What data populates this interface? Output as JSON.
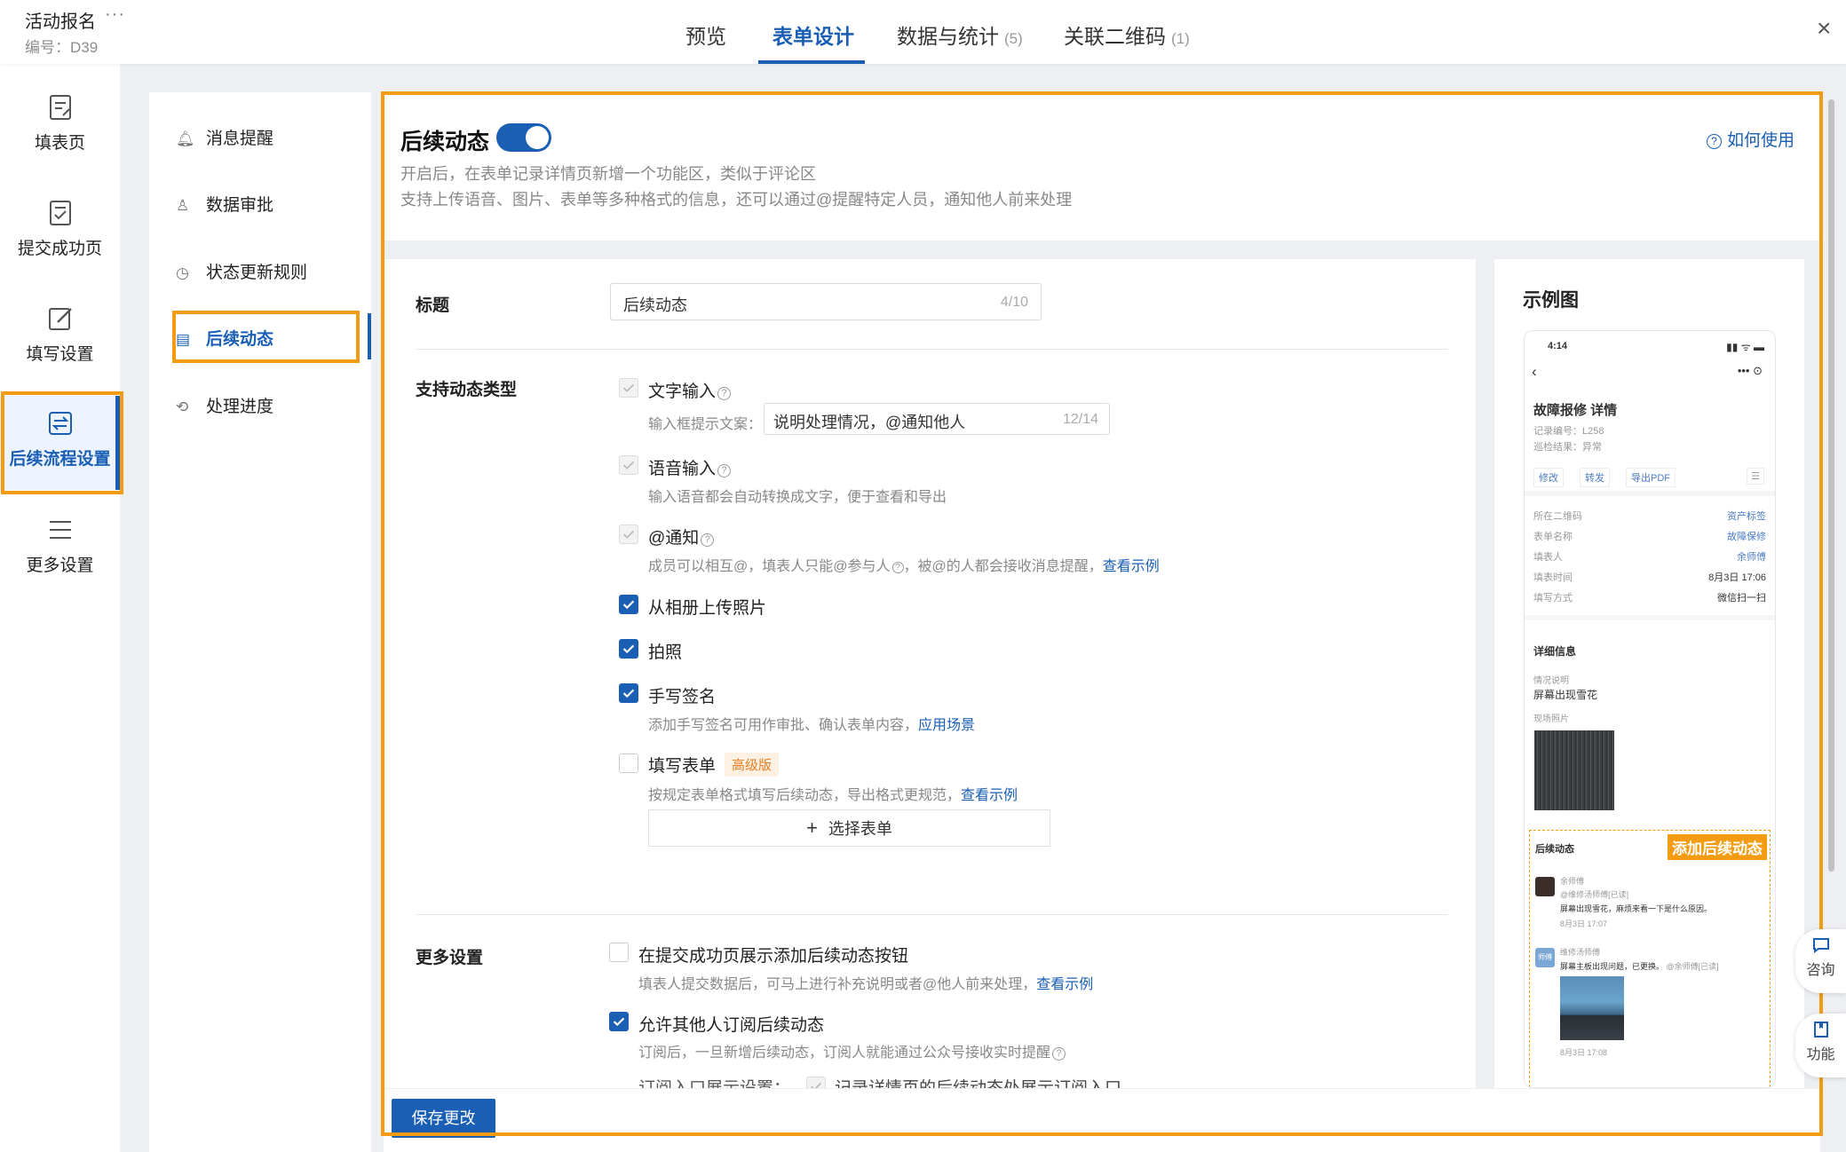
{
  "header": {
    "app_title": "活动报名",
    "more": "···",
    "code": "编号：D39",
    "tabs": [
      {
        "label": "预览",
        "count": ""
      },
      {
        "label": "表单设计",
        "count": ""
      },
      {
        "label": "数据与统计",
        "count": "(5)"
      },
      {
        "label": "关联二维码",
        "count": "(1)"
      }
    ],
    "active_tab": "表单设计",
    "close": "×"
  },
  "leftnav": {
    "items": [
      {
        "label": "填表页",
        "icon": "form-page-icon"
      },
      {
        "label": "提交成功页",
        "icon": "submit-success-icon"
      },
      {
        "label": "填写设置",
        "icon": "edit-settings-icon"
      },
      {
        "label": "后续流程设置",
        "icon": "follow-process-icon"
      },
      {
        "label": "更多设置",
        "icon": "menu-icon"
      }
    ],
    "active": "后续流程设置"
  },
  "subnav": {
    "items": [
      {
        "label": "消息提醒",
        "icon": "bell-icon"
      },
      {
        "label": "数据审批",
        "icon": "approval-icon"
      },
      {
        "label": "状态更新规则",
        "icon": "status-rule-icon"
      },
      {
        "label": "后续动态",
        "icon": "follow-activity-icon"
      },
      {
        "label": "处理进度",
        "icon": "progress-icon"
      }
    ],
    "active": "后续动态"
  },
  "main": {
    "title": "后续动态",
    "enabled": true,
    "how_to_use": "如何使用",
    "desc_line1": "开启后，在表单记录详情页新增一个功能区，类似于评论区",
    "desc_line2": "支持上传语音、图片、表单等多种格式的信息，还可以通过@提醒特定人员，通知他人前来处理"
  },
  "form": {
    "title_label": "标题",
    "title_value": "后续动态",
    "title_count": "4/10",
    "types_label": "支持动态类型",
    "text_input": {
      "label": "文字输入",
      "placeholder_label": "输入框提示文案：",
      "placeholder_value": "说明处理情况，@通知他人",
      "placeholder_count": "12/14"
    },
    "voice_input": {
      "label": "语音输入",
      "desc": "输入语音都会自动转换成文字，便于查看和导出"
    },
    "notify": {
      "label": "@通知",
      "desc_a": "成员可以相互@，填表人只能@参与人",
      "desc_b": "，被@的人都会接收消息提醒，",
      "link": "查看示例"
    },
    "upload_album": {
      "label": "从相册上传照片",
      "checked": true
    },
    "take_photo": {
      "label": "拍照",
      "checked": true
    },
    "signature": {
      "label": "手写签名",
      "checked": true,
      "desc": "添加手写签名可用作审批、确认表单内容，",
      "link": "应用场景"
    },
    "fill_form": {
      "label": "填写表单",
      "checked": false,
      "badge": "高级版",
      "desc": "按规定表单格式填写后续动态，导出格式更规范，",
      "link": "查看示例",
      "select_button": "选择表单",
      "plus": "+"
    },
    "more_label": "更多设置",
    "show_button": {
      "label": "在提交成功页展示添加后续动态按钮",
      "checked": false,
      "desc": "填表人提交数据后，可马上进行补充说明或者@他人前来处理，",
      "link": "查看示例"
    },
    "allow_subscribe": {
      "label": "允许其他人订阅后续动态",
      "checked": true,
      "desc": "订阅后，一旦新增后续动态，订阅人就能通过公众号接收实时提醒"
    },
    "subscribe_entry_label": "订阅入口展示设置：",
    "subscribe_entry_option": "记录详情页的后续动态处展示订阅入口",
    "save_button": "保存更改"
  },
  "sample": {
    "title": "示例图",
    "status_time": "4:14",
    "record_title": "故障报修 详情",
    "record_no": "记录编号：L258",
    "inspect": "巡检结果：异常",
    "actions": [
      "修改",
      "转发",
      "导出PDF"
    ],
    "fields": [
      {
        "k": "所在二维码",
        "v": "资产标签",
        "link": true
      },
      {
        "k": "表单名称",
        "v": "故障保修",
        "link": true
      },
      {
        "k": "填表人",
        "v": "余师傅",
        "link": true
      },
      {
        "k": "填表时间",
        "v": "8月3日 17:06",
        "link": false
      },
      {
        "k": "填写方式",
        "v": "微信扫一扫",
        "link": false
      }
    ],
    "detail_title": "详细信息",
    "situation_label": "情况说明",
    "situation_value": "屏幕出现雪花",
    "photo_label": "现场照片",
    "follow_title": "后续动态",
    "add_follow": "添加后续动态",
    "post1": {
      "name": "余师傅",
      "mention": "@维修汤师傅[已读]",
      "text": "屏幕出现雪花，麻烦来看一下是什么原因。",
      "time": "8月3日 17:07"
    },
    "post2": {
      "avatar_text": "师傅",
      "name": "维修汤师傅",
      "text": "屏幕主板出现问题，已更换。",
      "mention": "@余师傅[已读]",
      "time": "8月3日 17:08"
    }
  },
  "float": {
    "consult": "咨询",
    "feature": "功能"
  }
}
